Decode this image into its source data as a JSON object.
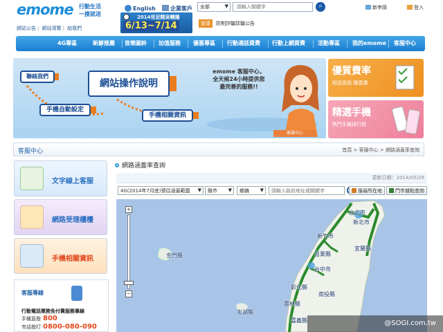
{
  "header": {
    "logo": "emome",
    "slogan_line1": "行動生活",
    "slogan_line2": "一摸就送",
    "english_label": "English",
    "enterprise_label": "企業客戶",
    "search_scope": "全部",
    "search_placeholder": "請輸入關鍵字",
    "new_apply": "新申請",
    "login": "登入",
    "promo_line1": "2014世足精采轉播",
    "promo_line2": "6/13~7/14",
    "notice_tag": "宣導",
    "notice_text": "防制詐騙詳騙公告",
    "quicklinks": [
      "網站公告",
      "網站導覽",
      "給我們"
    ]
  },
  "nav": [
    "4G專區",
    "新鮮推薦",
    "音樂圖鈴",
    "加值服務",
    "優惠專區",
    "行動通話資費",
    "行動上網資費",
    "活動專區",
    "我的emome",
    "客服中心"
  ],
  "hero": {
    "btn_contact": "聯絡我們",
    "btn_guide": "網站操作說明",
    "btn_settings": "手機自動設定",
    "btn_phone_info": "手機相關資訊",
    "text_line1": "emome 客服中心，",
    "text_line2": "全天候24小時提供您",
    "text_line3": "最完善的服務!!",
    "tag": "客服中心"
  },
  "promo_cards": [
    {
      "title": "優質費率",
      "sub": "短話長說 隨意講",
      "color": "#f39c2a"
    },
    {
      "title": "精選手機",
      "sub": "熱門手機排行榜",
      "color": "#ef7f9c"
    }
  ],
  "breadcrumb": {
    "title": "客服中心",
    "path": "首頁 > 客服中心 > 網路涵蓋率查詢"
  },
  "sidebar": [
    {
      "label": "文字線上客服",
      "color": "#2b6fc0"
    },
    {
      "label": "網路受理櫃檯",
      "color": "#2b6fc0"
    },
    {
      "label": "手機相關資訊",
      "color": "#e2461c"
    }
  ],
  "hotline": {
    "heading": "客服專線",
    "line1": "行動電話業務免付費服務專線",
    "mobile_label": "手機直撥",
    "mobile_number": "800",
    "landline_label": "市話撥打",
    "landline_number": "0800-080-090"
  },
  "main": {
    "heading": "網路涵蓋率查詢",
    "update_date": "更新日期：2014/05/29",
    "coverage_select": "4G(2014年7月底)預估涵蓋範圍",
    "county_select": "縣市",
    "town_select": "鄉鎮",
    "address_placeholder": "請輸入路段地址或關鍵字",
    "btn_locate": "搜尋所在地",
    "btn_store": "門市據點查詢"
  },
  "map": {
    "labels": [
      "金門縣",
      "澎湖縣",
      "新北市",
      "新竹市",
      "宜蘭縣",
      "苗栗縣",
      "台中市",
      "彰化縣",
      "南投縣",
      "雲林縣",
      "嘉義縣",
      "台北市"
    ],
    "watermark": "@SOGI.com.tw"
  }
}
